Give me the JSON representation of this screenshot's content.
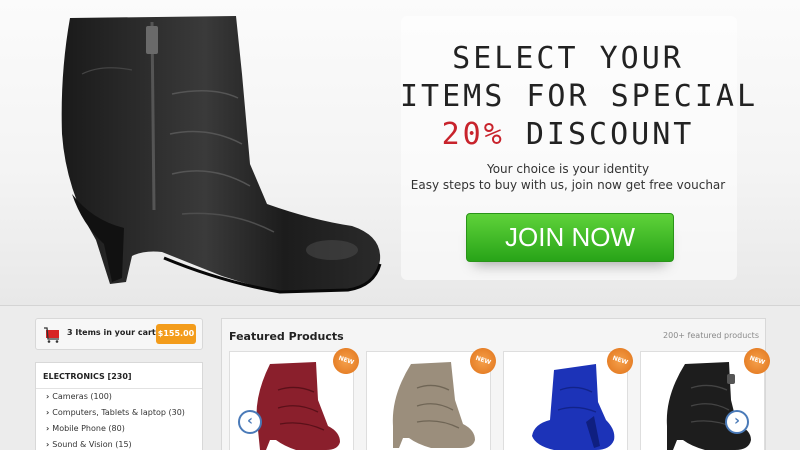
{
  "hero": {
    "headline_line1": "SELECT YOUR",
    "headline_line2": "ITEMS FOR SPECIAL",
    "headline_pct": "20%",
    "headline_rest": " DISCOUNT",
    "sub_line1": "Your choice is your identity",
    "sub_line2": "Easy steps to buy with us, join now get free vouchar",
    "join_label": "JOIN NOW",
    "accent_color": "#c8232c",
    "button_color": "#3cb521"
  },
  "cart": {
    "text": "3 Items in your cart",
    "price": "$155.00",
    "icon": "shopping-cart-icon"
  },
  "categories": {
    "header": "ELECTRONICS [230]",
    "items": [
      {
        "label": "Cameras (100)"
      },
      {
        "label": "Computers, Tablets & laptop (30)"
      },
      {
        "label": "Mobile Phone (80)"
      },
      {
        "label": "Sound & Vision (15)"
      }
    ]
  },
  "featured": {
    "title": "Featured Products",
    "count": "200+ featured products",
    "badge": "NEW",
    "products": [
      {
        "color": "#8a1f2c",
        "badge": "NEW"
      },
      {
        "color": "#9b8e7c",
        "badge": "NEW"
      },
      {
        "color": "#1c33b8",
        "badge": "NEW"
      },
      {
        "color": "#1d1d1d",
        "badge": "NEW"
      }
    ],
    "prev_icon": "chevron-left-icon",
    "next_icon": "chevron-right-icon"
  }
}
